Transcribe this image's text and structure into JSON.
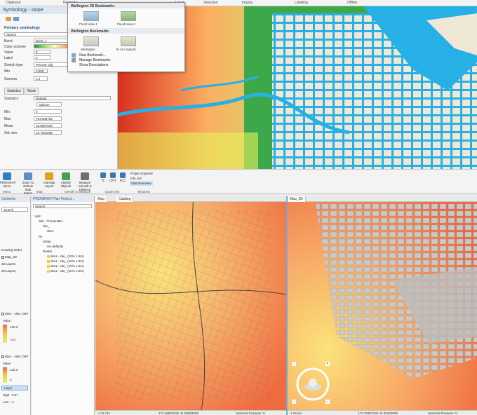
{
  "ribbon_tabs": [
    "Clipboard",
    "Navigate",
    "Layer",
    "Selection",
    "Inquiry",
    "Labeling",
    "Offline"
  ],
  "symbology": {
    "title": "Symbology - slope",
    "primary": "Primary symbology",
    "renderer": "Stretch",
    "rows": [
      {
        "label": "Band",
        "value": "Band_1"
      },
      {
        "label": "Color scheme",
        "value": ""
      },
      {
        "label": "Value",
        "value": "0"
      },
      {
        "label": "Label",
        "value": "0"
      },
      {
        "label": "Stretch type",
        "value": "Percent Clip"
      },
      {
        "label": "Min",
        "value": "0.000"
      },
      {
        "label": "Gamma",
        "value": "1.0"
      }
    ],
    "tabs": [
      "Statistics",
      "Mask"
    ],
    "stats_label": "Statistics",
    "stats_value": "Dataset",
    "options": "Options",
    "stat_rows": [
      {
        "label": "Min",
        "value": "0"
      },
      {
        "label": "Max",
        "value": "78.0405763"
      },
      {
        "label": "Mean",
        "value": "15.6667039"
      },
      {
        "label": "Std. dev",
        "value": "15.7002098"
      }
    ]
  },
  "bookmarks": {
    "header1": "Wellington 3D Bookmarks",
    "thumbs1": [
      "Flood View 1",
      "Flood View 2"
    ],
    "header2": "Wellington Bookmarks",
    "thumbs2": [
      "Wellington",
      "Te Aro Suburb"
    ],
    "items": [
      "New Bookmark...",
      "Manage Bookmarks",
      "Show Descriptions"
    ]
  },
  "ribbon_buttons": [
    {
      "label": "PROGIRA® Menu",
      "color": "#2f7fc1"
    },
    {
      "label": "Zoom To Default Map Extent",
      "color": "#5a8fc9"
    },
    {
      "label": "Add Map Layers",
      "color": "#e0a21a"
    },
    {
      "label": "Identify Objects",
      "color": "#4aa04a"
    },
    {
      "label": "Measure Azimuth & Distance",
      "color": "#6e6e6e"
    },
    {
      "label": "TL",
      "color": "#3b76b6"
    },
    {
      "label": "CIPT",
      "color": "#3b76b6"
    },
    {
      "label": "FCC",
      "color": "#3b76b6"
    }
  ],
  "ribbon_groups": [
    "Menu",
    "Map",
    "Identify & Measure",
    "Quick Info",
    "Windows"
  ],
  "windows_list": [
    "Project Explorer",
    "Info List",
    "Data Overview"
  ],
  "contents": {
    "title": "Contents",
    "search": "Search",
    "drawing_order": "Drawing Order",
    "items": [
      "Map_3D",
      "3D Layers",
      "2D Layers"
    ],
    "layer1": "site1 - site1 OBT",
    "value_label": "Value",
    "v_high": "120.3",
    "v_mid": "-4.3",
    "layer2": "site1 - site1 OBT",
    "v_high2": "120.3",
    "v_low2": "3",
    "layer_btn": "Layer",
    "high": "High : 0.07",
    "low": "Low : -1"
  },
  "progira": {
    "title": "PROGIRA® Plan Project...",
    "search": "Search",
    "nodes": [
      "Vol2",
      "Site - Transmitter",
      "site_",
      "site1",
      "Rx",
      "Setup",
      "rec.defaults",
      "Raster",
      "site1 - site_ (10% 1.5m)",
      "site1 - site_ (10% 1.5m)",
      "site1 - site_ (10% 1.5m)",
      "site1 - site_ (10% 1.5m)"
    ]
  },
  "map2d": {
    "tab": "Map",
    "tab2": "Catalog",
    "scale": "1:11,721",
    "coords": "174.4860251E 41.2962886S",
    "selected": "Selected Features: 0"
  },
  "map3d": {
    "tab": "Map_3D",
    "scale": "1.26 km",
    "coords": "174.7830741E 41.2942080S",
    "selected": "Selected Features: 0"
  }
}
